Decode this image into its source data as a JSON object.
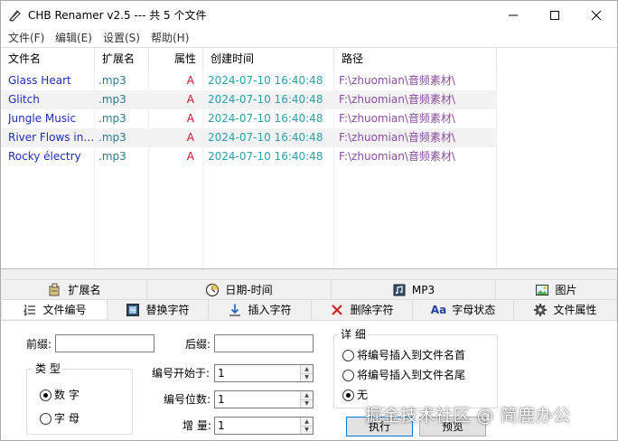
{
  "window": {
    "title": "CHB Renamer v2.5 --- 共 5 个文件"
  },
  "menu": [
    "文件(F)",
    "编辑(E)",
    "设置(S)",
    "帮助(H)"
  ],
  "list": {
    "columns": [
      "文件名",
      "扩展名",
      "属性",
      "创建时间",
      "路径"
    ],
    "rows": [
      {
        "name": "Glass Heart",
        "ext": ".mp3",
        "attr": "A",
        "time": "2024-07-10 16:40:48",
        "path": "F:\\zhuomian\\音频素材\\"
      },
      {
        "name": "Glitch",
        "ext": ".mp3",
        "attr": "A",
        "time": "2024-07-10 16:40:48",
        "path": "F:\\zhuomian\\音频素材\\"
      },
      {
        "name": "Jungle Music",
        "ext": ".mp3",
        "attr": "A",
        "time": "2024-07-10 16:40:48",
        "path": "F:\\zhuomian\\音频素材\\"
      },
      {
        "name": "River Flows in ...",
        "ext": ".mp3",
        "attr": "A",
        "time": "2024-07-10 16:40:48",
        "path": "F:\\zhuomian\\音频素材\\"
      },
      {
        "name": "Rocky électry",
        "ext": ".mp3",
        "attr": "A",
        "time": "2024-07-10 16:40:48",
        "path": "F:\\zhuomian\\音频素材\\"
      }
    ]
  },
  "tabs_row1": [
    {
      "label": "扩展名",
      "icon": "puzzle-icon"
    },
    {
      "label": "日期-时间",
      "icon": "clock-icon"
    },
    {
      "label": "MP3",
      "icon": "music-note-icon"
    },
    {
      "label": "图片",
      "icon": "picture-icon"
    }
  ],
  "tabs_row2": [
    {
      "label": "文件编号",
      "icon": "numbered-list-icon",
      "active": true
    },
    {
      "label": "替换字符",
      "icon": "replace-icon"
    },
    {
      "label": "插入字符",
      "icon": "insert-arrow-icon"
    },
    {
      "label": "删除字符",
      "icon": "delete-x-icon"
    },
    {
      "label": "字母状态",
      "icon": "text-case-icon",
      "glyph": "Aa"
    },
    {
      "label": "文件属性",
      "icon": "gear-icon"
    }
  ],
  "panel": {
    "prefix_label": "前缀:",
    "prefix_value": "",
    "suffix_label": "后缀:",
    "suffix_value": "",
    "type_group": "类 型",
    "type_options": [
      "数 字",
      "字 母"
    ],
    "type_selected": 0,
    "start_label": "编号开始于:",
    "start_value": "1",
    "digits_label": "编号位数:",
    "digits_value": "1",
    "step_label": "增 量:",
    "step_value": "1",
    "detail_group": "详 细",
    "detail_options": [
      "将编号插入到文件名首",
      "将编号插入到文件名尾",
      "无"
    ],
    "detail_selected": 2,
    "execute_label": "执行",
    "preview_label": "预览"
  },
  "watermark": "掘金技术社区 @ 简鹿办公",
  "colors": {
    "name": "#1d2bb8",
    "ext": "#2a7a8c",
    "attr": "#c8102e",
    "time": "#2aa0a8",
    "path": "#8a4a9e",
    "accent": "#0078d7"
  }
}
